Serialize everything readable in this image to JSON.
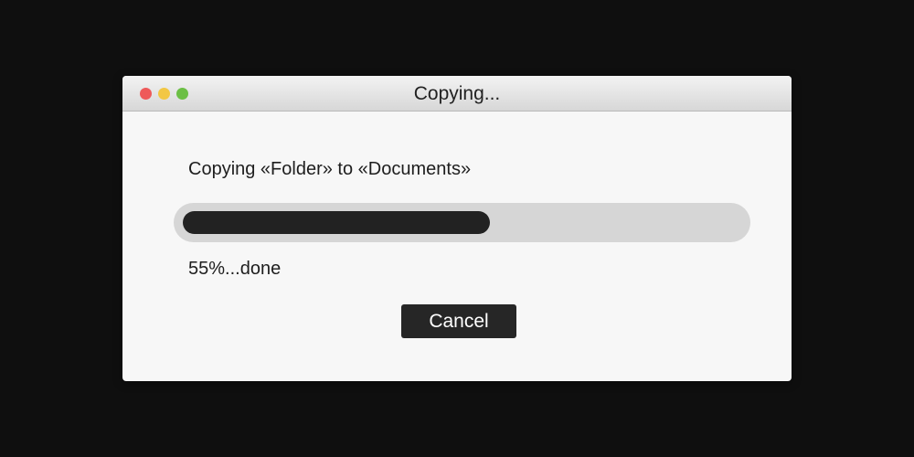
{
  "window": {
    "title": "Copying...",
    "controls": [
      {
        "name": "close",
        "color": "#ee5a5a"
      },
      {
        "name": "minimize",
        "color": "#f2c744"
      },
      {
        "name": "maximize",
        "color": "#6cbf45"
      }
    ]
  },
  "dialog": {
    "message": "Copying «Folder» to «Documents»",
    "progress": 55,
    "status_text": "55%...done",
    "cancel_label": "Cancel"
  },
  "colors": {
    "background": "#0f0f0f",
    "window": "#f7f7f7",
    "track": "#d6d6d6",
    "fill": "#222222",
    "button": "#262626"
  }
}
